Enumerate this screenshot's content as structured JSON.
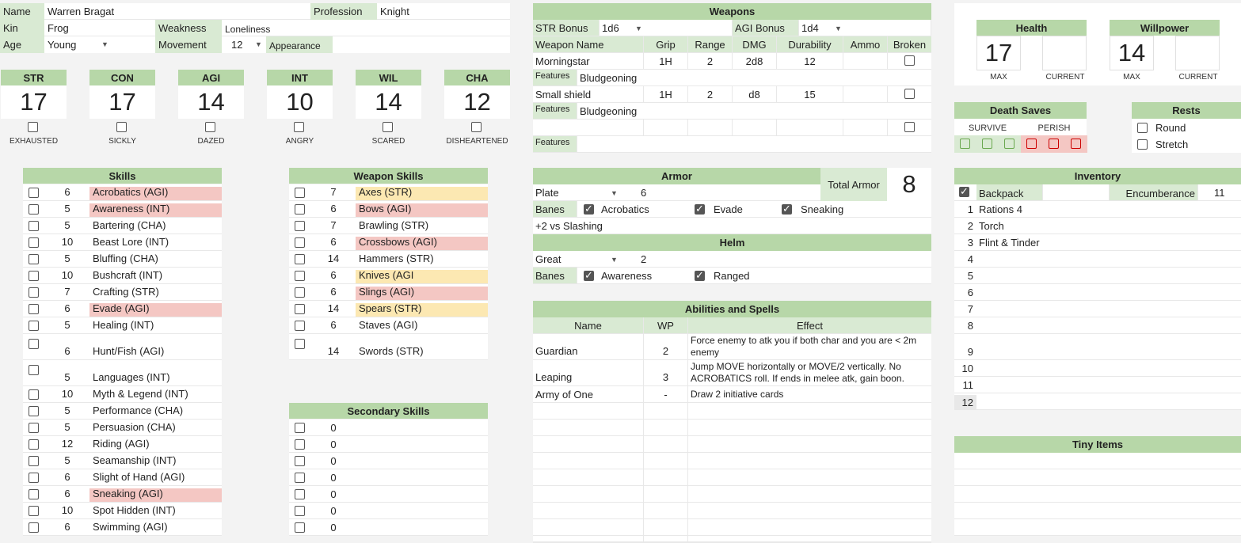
{
  "character": {
    "name_label": "Name",
    "name": "Warren Bragat",
    "profession_label": "Profession",
    "profession": "Knight",
    "kin_label": "Kin",
    "kin": "Frog",
    "weakness_label": "Weakness",
    "weakness": "Loneliness",
    "age_label": "Age",
    "age": "Young",
    "movement_label": "Movement",
    "movement": "12",
    "appearance_label": "Appearance"
  },
  "attributes": [
    {
      "name": "STR",
      "value": "17",
      "condition": "EXHAUSTED"
    },
    {
      "name": "CON",
      "value": "17",
      "condition": "SICKLY"
    },
    {
      "name": "AGI",
      "value": "14",
      "condition": "DAZED"
    },
    {
      "name": "INT",
      "value": "10",
      "condition": "ANGRY"
    },
    {
      "name": "WIL",
      "value": "14",
      "condition": "SCARED"
    },
    {
      "name": "CHA",
      "value": "12",
      "condition": "DISHEARTENED"
    }
  ],
  "skills": {
    "title": "Skills",
    "items": [
      {
        "v": "6",
        "n": "Acrobatics (AGI)",
        "hl": "red"
      },
      {
        "v": "5",
        "n": "Awareness (INT)",
        "hl": "red"
      },
      {
        "v": "5",
        "n": "Bartering (CHA)",
        "hl": ""
      },
      {
        "v": "10",
        "n": "Beast Lore (INT)",
        "hl": ""
      },
      {
        "v": "5",
        "n": "Bluffing (CHA)",
        "hl": ""
      },
      {
        "v": "10",
        "n": "Bushcraft (INT)",
        "hl": ""
      },
      {
        "v": "7",
        "n": "Crafting (STR)",
        "hl": ""
      },
      {
        "v": "6",
        "n": "Evade (AGI)",
        "hl": "red"
      },
      {
        "v": "5",
        "n": "Healing (INT)",
        "hl": ""
      },
      {
        "v": "6",
        "n": "Hunt/Fish (AGI)",
        "hl": ""
      },
      {
        "v": "5",
        "n": "Languages (INT)",
        "hl": ""
      },
      {
        "v": "10",
        "n": "Myth & Legend (INT)",
        "hl": ""
      },
      {
        "v": "5",
        "n": "Performance (CHA)",
        "hl": ""
      },
      {
        "v": "5",
        "n": "Persuasion (CHA)",
        "hl": ""
      },
      {
        "v": "12",
        "n": "Riding (AGI)",
        "hl": ""
      },
      {
        "v": "5",
        "n": "Seamanship (INT)",
        "hl": ""
      },
      {
        "v": "6",
        "n": "Slight of Hand (AGI)",
        "hl": ""
      },
      {
        "v": "6",
        "n": "Sneaking (AGI)",
        "hl": "red"
      },
      {
        "v": "10",
        "n": "Spot Hidden (INT)",
        "hl": ""
      },
      {
        "v": "6",
        "n": "Swimming (AGI)",
        "hl": ""
      }
    ]
  },
  "weapon_skills": {
    "title": "Weapon Skills",
    "items": [
      {
        "v": "7",
        "n": "Axes (STR)",
        "hl": "yel"
      },
      {
        "v": "6",
        "n": "Bows (AGI)",
        "hl": "red"
      },
      {
        "v": "7",
        "n": "Brawling (STR)",
        "hl": ""
      },
      {
        "v": "6",
        "n": "Crossbows (AGI)",
        "hl": "red"
      },
      {
        "v": "14",
        "n": "Hammers (STR)",
        "hl": ""
      },
      {
        "v": "6",
        "n": "Knives (AGI",
        "hl": "yel"
      },
      {
        "v": "6",
        "n": "Slings (AGI)",
        "hl": "red"
      },
      {
        "v": "14",
        "n": "Spears (STR)",
        "hl": "yel"
      },
      {
        "v": "6",
        "n": "Staves (AGI)",
        "hl": ""
      },
      {
        "v": "14",
        "n": "Swords (STR)",
        "hl": ""
      }
    ]
  },
  "secondary_skills": {
    "title": "Secondary Skills",
    "items": [
      "0",
      "0",
      "0",
      "0",
      "0",
      "0",
      "0"
    ]
  },
  "weapons": {
    "title": "Weapons",
    "str_bonus_label": "STR Bonus",
    "str_bonus": "1d6",
    "agi_bonus_label": "AGI Bonus",
    "agi_bonus": "1d4",
    "headers": [
      "Weapon Name",
      "Grip",
      "Range",
      "DMG",
      "Durability",
      "Ammo",
      "Broken"
    ],
    "features_label": "Features",
    "rows": [
      {
        "name": "Morningstar",
        "grip": "1H",
        "range": "2",
        "dmg": "2d8",
        "dur": "12",
        "features": "Bludgeoning"
      },
      {
        "name": "Small shield",
        "grip": "1H",
        "range": "2",
        "dmg": "d8",
        "dur": "15",
        "features": "Bludgeoning"
      },
      {
        "name": "",
        "grip": "",
        "range": "",
        "dmg": "",
        "dur": "",
        "features": ""
      }
    ]
  },
  "armor": {
    "title": "Armor",
    "type": "Plate",
    "rating": "6",
    "total_label": "Total Armor",
    "total": "8",
    "banes_label": "Banes",
    "banes": [
      "Acrobatics",
      "Evade",
      "Sneaking"
    ],
    "note": "+2 vs Slashing"
  },
  "helm": {
    "title": "Helm",
    "type": "Great",
    "rating": "2",
    "banes_label": "Banes",
    "banes": [
      "Awareness",
      "Ranged"
    ]
  },
  "abilities": {
    "title": "Abilities and Spells",
    "headers": [
      "Name",
      "WP",
      "Effect"
    ],
    "rows": [
      {
        "name": "Guardian",
        "wp": "2",
        "effect": "Force enemy to atk you if both char and you are < 2m enemy"
      },
      {
        "name": "Leaping",
        "wp": "3",
        "effect": "Jump MOVE horizontally or MOVE/2 vertically. No ACROBATICS roll. If ends in melee atk, gain boon."
      },
      {
        "name": "Army of One",
        "wp": "-",
        "effect": "Draw 2 initiative cards"
      }
    ]
  },
  "health": {
    "title": "Health",
    "max": "17",
    "current": "",
    "max_label": "MAX",
    "current_label": "CURRENT"
  },
  "willpower": {
    "title": "Willpower",
    "max": "14",
    "current": "",
    "max_label": "MAX",
    "current_label": "CURRENT"
  },
  "death_saves": {
    "title": "Death Saves",
    "survive_label": "SURVIVE",
    "perish_label": "PERISH"
  },
  "rests": {
    "title": "Rests",
    "items": [
      "Round",
      "Stretch"
    ]
  },
  "inventory": {
    "title": "Inventory",
    "backpack_label": "Backpack",
    "encumbrance_label": "Encumberance",
    "encumbrance": "11",
    "items": [
      {
        "n": "1",
        "v": "Rations 4"
      },
      {
        "n": "2",
        "v": "Torch"
      },
      {
        "n": "3",
        "v": "Flint & Tinder"
      },
      {
        "n": "4",
        "v": ""
      },
      {
        "n": "5",
        "v": ""
      },
      {
        "n": "6",
        "v": ""
      },
      {
        "n": "7",
        "v": ""
      },
      {
        "n": "8",
        "v": ""
      },
      {
        "n": "9",
        "v": ""
      },
      {
        "n": "10",
        "v": ""
      },
      {
        "n": "11",
        "v": ""
      },
      {
        "n": "12",
        "v": ""
      }
    ]
  },
  "tiny_items": {
    "title": "Tiny Items"
  }
}
